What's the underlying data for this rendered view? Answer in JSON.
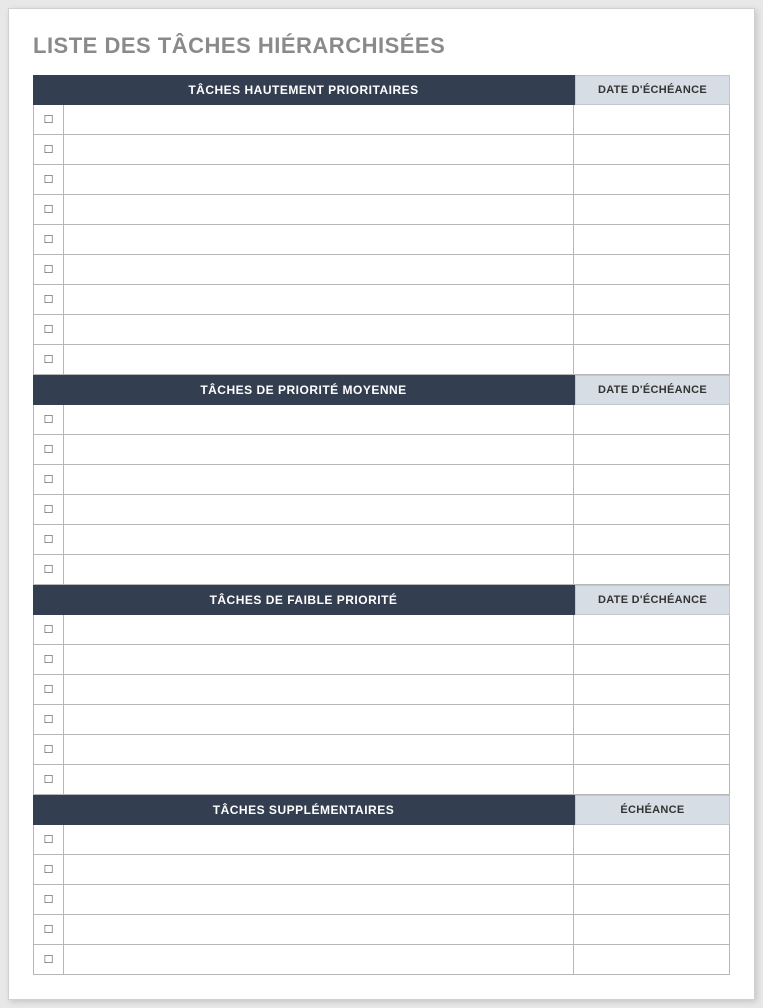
{
  "title": "LISTE DES TÂCHES HIÉRARCHISÉES",
  "checkbox_glyph": "☐",
  "sections": [
    {
      "header_left": "TÂCHES HAUTEMENT PRIORITAIRES",
      "header_right": "DATE D'ÉCHÉANCE",
      "rows": [
        {
          "task": "",
          "date": ""
        },
        {
          "task": "",
          "date": ""
        },
        {
          "task": "",
          "date": ""
        },
        {
          "task": "",
          "date": ""
        },
        {
          "task": "",
          "date": ""
        },
        {
          "task": "",
          "date": ""
        },
        {
          "task": "",
          "date": ""
        },
        {
          "task": "",
          "date": ""
        },
        {
          "task": "",
          "date": ""
        }
      ]
    },
    {
      "header_left": "TÂCHES DE PRIORITÉ MOYENNE",
      "header_right": "DATE D'ÉCHÉANCE",
      "rows": [
        {
          "task": "",
          "date": ""
        },
        {
          "task": "",
          "date": ""
        },
        {
          "task": "",
          "date": ""
        },
        {
          "task": "",
          "date": ""
        },
        {
          "task": "",
          "date": ""
        },
        {
          "task": "",
          "date": ""
        }
      ]
    },
    {
      "header_left": "TÂCHES DE FAIBLE PRIORITÉ",
      "header_right": "DATE D'ÉCHÉANCE",
      "rows": [
        {
          "task": "",
          "date": ""
        },
        {
          "task": "",
          "date": ""
        },
        {
          "task": "",
          "date": ""
        },
        {
          "task": "",
          "date": ""
        },
        {
          "task": "",
          "date": ""
        },
        {
          "task": "",
          "date": ""
        }
      ]
    },
    {
      "header_left": "TÂCHES SUPPLÉMENTAIRES",
      "header_right": "ÉCHÉANCE",
      "rows": [
        {
          "task": "",
          "date": ""
        },
        {
          "task": "",
          "date": ""
        },
        {
          "task": "",
          "date": ""
        },
        {
          "task": "",
          "date": ""
        },
        {
          "task": "",
          "date": ""
        }
      ]
    }
  ]
}
